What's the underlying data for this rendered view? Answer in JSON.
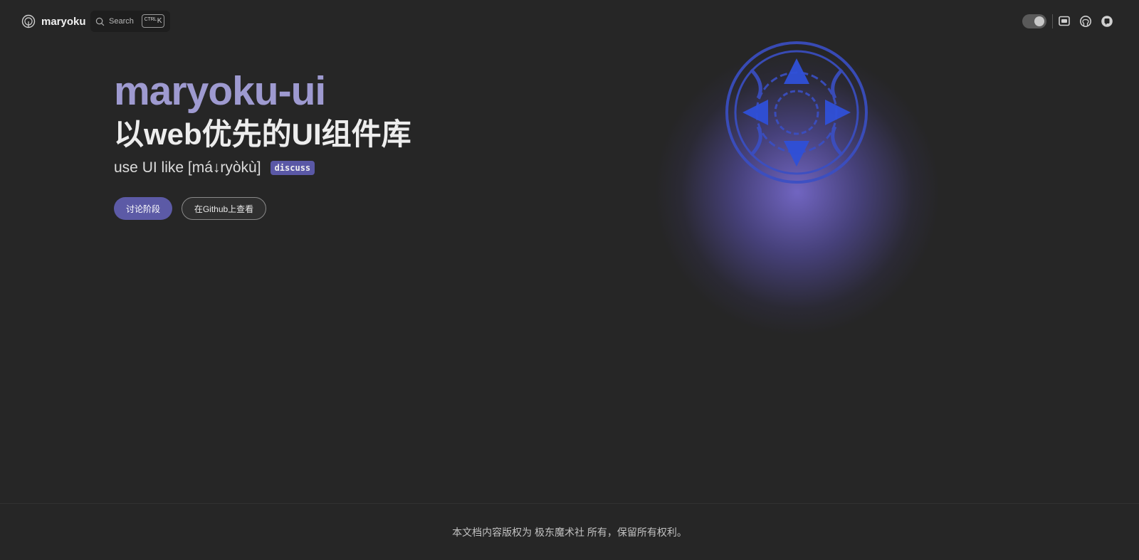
{
  "nav": {
    "brand": "maryoku",
    "search_label": "Search",
    "shortcut_mod": "CTRL",
    "shortcut_key": "K",
    "icons": [
      "theme-toggle",
      "discord-icon",
      "github-icon",
      "qq-icon"
    ]
  },
  "hero": {
    "title": "maryoku-ui",
    "subtitle": "以web优先的UI组件库",
    "tagline": "use UI like [má↓ryòkù]",
    "badge": "discuss",
    "primary_button": "讨论阶段",
    "secondary_button": "在Github上查看"
  },
  "footer": {
    "copyright": "本文档内容版权为 极东魔术社 所有，保留所有权利。"
  },
  "colors": {
    "background": "#262626",
    "accent": "#5c5aa6",
    "title": "#9e9ad0"
  }
}
